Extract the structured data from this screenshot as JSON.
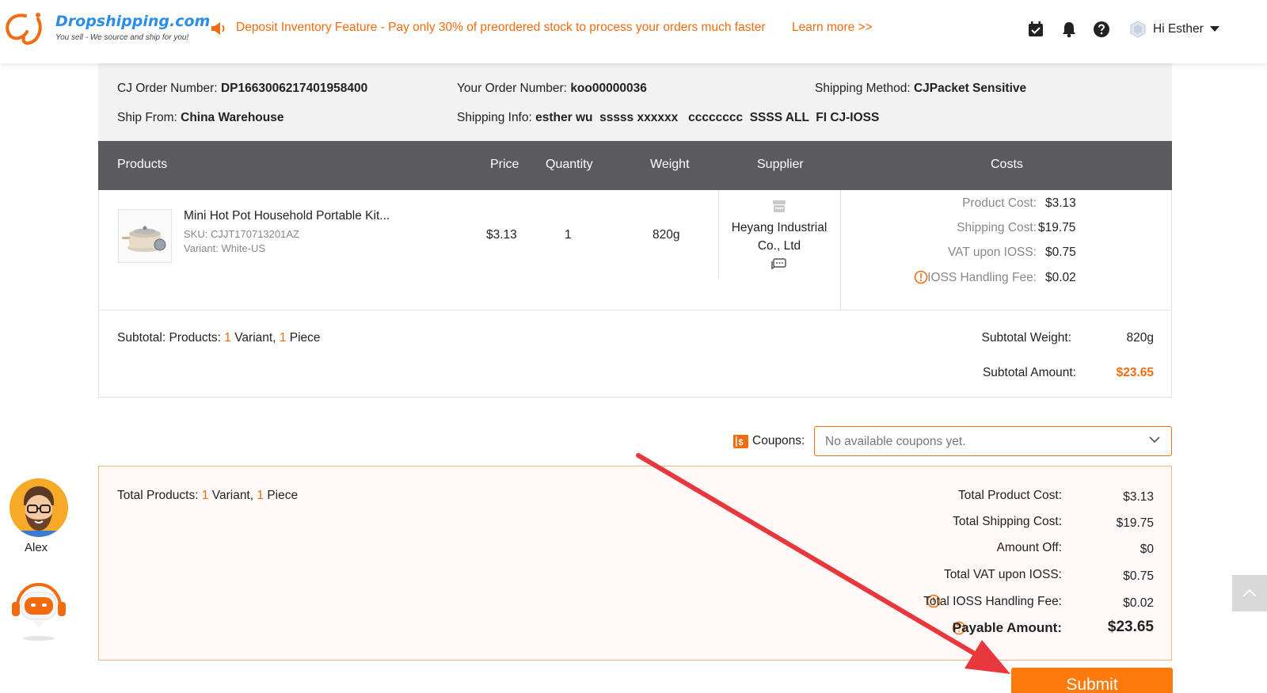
{
  "header": {
    "logo_title": "Dropshipping.com",
    "logo_subtitle": "You sell - We source and ship for you!",
    "announcement": "Deposit Inventory Feature - Pay only 30% of preordered stock to process your orders much faster",
    "learn_more": "Learn more >>",
    "icons": [
      "calendar-check-icon",
      "bell-icon",
      "help-icon"
    ],
    "greeting": "Hi Esther"
  },
  "order": {
    "cj_order_label": "CJ Order Number:",
    "cj_order_value": "DP1663006217401958400",
    "your_order_label": "Your Order Number:",
    "your_order_value": "koo00000036",
    "shipping_method_label": "Shipping Method:",
    "shipping_method_value": "CJPacket Sensitive",
    "ship_from_label": "Ship From:",
    "ship_from_value": "China Warehouse",
    "shipping_info_label": "Shipping Info:",
    "shipping_info_value": "esther wu  sssss xxxxxx   cccccccc  SSSS ALL  FI CJ-IOSS"
  },
  "table": {
    "headers": [
      "Products",
      "Price",
      "Quantity",
      "Weight",
      "Supplier",
      "Costs"
    ]
  },
  "product": {
    "name": "Mini Hot Pot Household Portable Kit...",
    "sku": "SKU: CJJT170713201AZ",
    "variant": "Variant: White-US",
    "price": "$3.13",
    "quantity": "1",
    "weight": "820g",
    "supplier": "Heyang Industrial Co., Ltd"
  },
  "costs": {
    "product_cost_label": "Product Cost:",
    "product_cost_value": "$3.13",
    "shipping_cost_label": "Shipping Cost:",
    "shipping_cost_value": "$19.75",
    "vat_label": "VAT upon IOSS:",
    "vat_value": "$0.75",
    "ioss_fee_label": "IOSS Handling Fee:",
    "ioss_fee_value": "$0.02"
  },
  "subtotal": {
    "products_label": "Subtotal: Products:",
    "variant_count": "1",
    "variant_word": "Variant,",
    "piece_count": "1",
    "piece_word": "Piece",
    "weight_label": "Subtotal Weight:",
    "weight_value": "820g",
    "amount_label": "Subtotal Amount:",
    "amount_value": "$23.65"
  },
  "coupons": {
    "label": "Coupons:",
    "selected": "No available coupons yet."
  },
  "totals": {
    "products_label": "Total Products:",
    "variant_count": "1",
    "variant_word": "Variant,",
    "piece_count": "1",
    "piece_word": "Piece",
    "product_cost_label": "Total Product Cost:",
    "product_cost_value": "$3.13",
    "shipping_cost_label": "Total Shipping Cost:",
    "shipping_cost_value": "$19.75",
    "amount_off_label": "Amount Off:",
    "amount_off_value": "$0",
    "vat_label": "Total VAT upon IOSS:",
    "vat_value": "$0.75",
    "ioss_fee_label": "Total IOSS Handling Fee:",
    "ioss_fee_value": "$0.02",
    "payable_label": "Payable Amount:",
    "payable_value": "$23.65"
  },
  "submit_label": "Submit",
  "agent_name": "Alex",
  "colors": {
    "accent": "#f26b0f",
    "header_bar": "#5b5b5e",
    "annotation_arrow": "#e8373d"
  }
}
